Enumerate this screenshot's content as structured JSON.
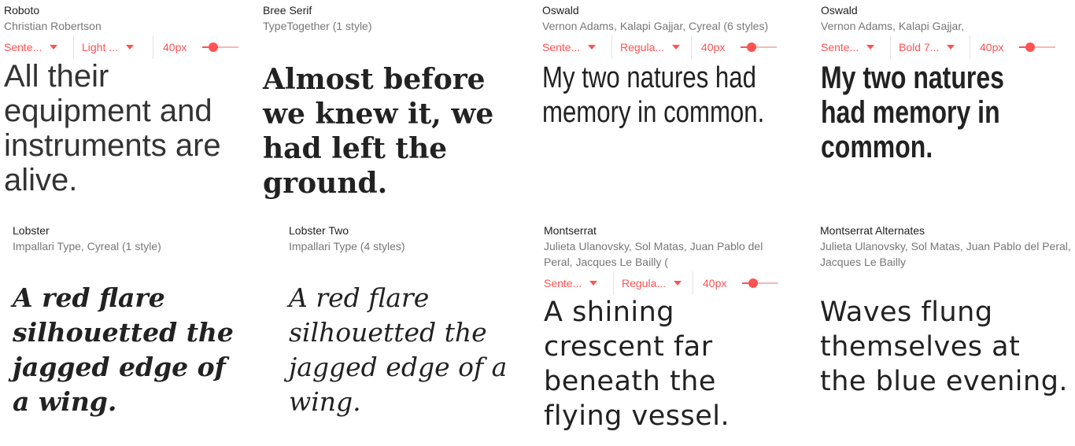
{
  "accent_color": "#ff5252",
  "cards": [
    {
      "name": "Roboto",
      "designer": "Christian Robertson",
      "controls": {
        "case_label": "Sente...",
        "weight_label": "Light ...",
        "size_label": "40px",
        "size_value": 40
      },
      "sample": "All their equipment and instruments are alive."
    },
    {
      "name": "Bree Serif",
      "designer": "TypeTogether (1 style)",
      "sample": "Almost before we knew it, we had left the ground."
    },
    {
      "name": "Oswald",
      "designer": "Vernon Adams, Kalapi Gajjar, Cyreal (6 styles)",
      "controls": {
        "case_label": "Sente...",
        "weight_label": "Regula...",
        "size_label": "40px",
        "size_value": 40
      },
      "sample": "My two natures had memory in common."
    },
    {
      "name": "Oswald",
      "designer": "Vernon Adams, Kalapi Gajjar,",
      "controls": {
        "case_label": "Sente...",
        "weight_label": "Bold 7...",
        "size_label": "40px",
        "size_value": 40
      },
      "sample": "My two natures had memory in common."
    },
    {
      "name": "Lobster",
      "designer": "Impallari Type, Cyreal (1 style)",
      "sample": "A red flare silhouetted the jagged edge of a wing."
    },
    {
      "name": "Lobster Two",
      "designer": "Impallari Type (4 styles)",
      "sample": "A red flare silhouetted the jagged edge of a wing."
    },
    {
      "name": "Montserrat",
      "designer": "Julieta Ulanovsky, Sol Matas, Juan Pablo del Peral, Jacques Le Bailly (",
      "controls": {
        "case_label": "Sente...",
        "weight_label": "Regula...",
        "size_label": "40px",
        "size_value": 40
      },
      "sample": "A shining crescent far beneath the flying vessel."
    },
    {
      "name": "Montserrat Alternates",
      "designer": "Julieta Ulanovsky, Sol Matas, Juan Pablo del Peral, Jacques Le Bailly",
      "sample": "Waves flung themselves at the blue evening."
    }
  ]
}
